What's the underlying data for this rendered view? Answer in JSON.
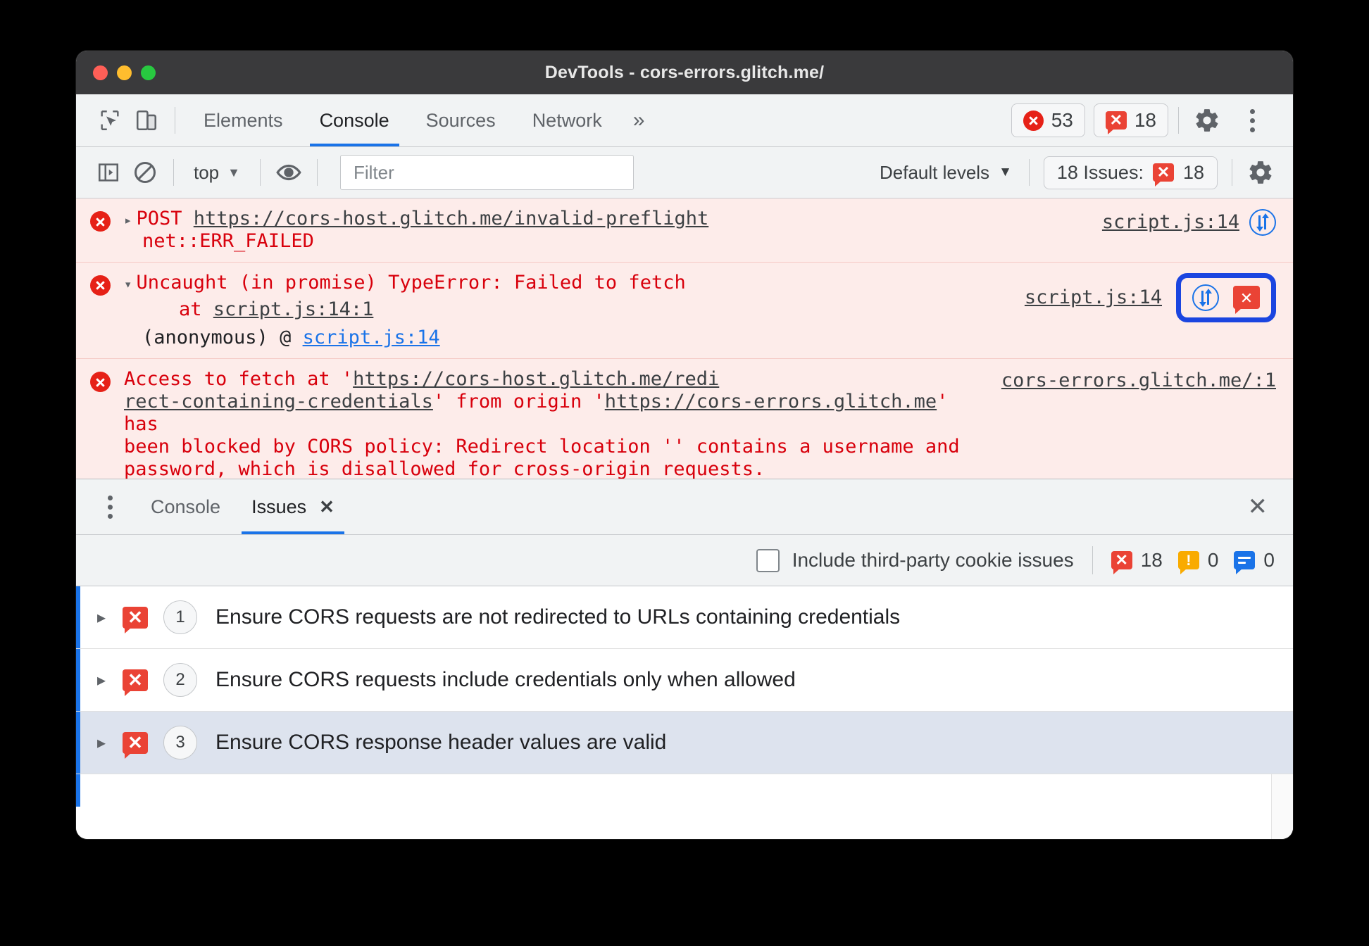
{
  "window": {
    "title": "DevTools - cors-errors.glitch.me/",
    "traffic_lights": [
      "close-red",
      "minimize-yellow",
      "maximize-green"
    ]
  },
  "main_toolbar": {
    "inspect_icon": "inspect-element-icon",
    "device_icon": "device-toolbar-icon",
    "tabs": [
      {
        "label": "Elements",
        "active": false
      },
      {
        "label": "Console",
        "active": true
      },
      {
        "label": "Sources",
        "active": false
      },
      {
        "label": "Network",
        "active": false
      }
    ],
    "more_tabs": "»",
    "error_count": "53",
    "issue_count": "18",
    "settings_icon": "gear-icon",
    "more_icon": "kebab-menu-icon"
  },
  "console_toolbar": {
    "sidebar_icon": "console-sidebar-icon",
    "clear_icon": "clear-console-icon",
    "context": "top",
    "context_caret": "▼",
    "eye_icon": "live-expression-eye-icon",
    "filter_placeholder": "Filter",
    "filter_value": "",
    "levels_label": "Default levels",
    "levels_caret": "▼",
    "issues_label": "18 Issues:",
    "issues_count": "18",
    "settings_icon": "console-settings-gear-icon"
  },
  "console_messages": [
    {
      "expander": "▸",
      "method": "POST",
      "url": "https://cors-host.glitch.me/invalid-preflight",
      "detail": "net::ERR_FAILED",
      "source": "script.js:14",
      "network_icon": "network-request-icon",
      "highlighted": false
    },
    {
      "expander": "▾",
      "text": "Uncaught (in promise) TypeError: Failed to fetch",
      "at_label": "at",
      "at_link": "script.js:14:1",
      "stack_prefix": "(anonymous) @ ",
      "stack_link": "script.js:14",
      "source": "script.js:14",
      "network_icon": "network-request-icon",
      "issue_icon": "issue-bubble-icon",
      "highlighted": true
    },
    {
      "line1_pre": "Access to fetch at '",
      "line1_link": "https://cors-host.glitch.me/redi",
      "line2_link": "rect-containing-credentials",
      "line2_mid": "' from origin '",
      "line2_link2": "https://cors-errors.glitch.me",
      "line2_post": "' has",
      "line3": "been blocked by CORS policy: Redirect location '' contains a username and",
      "line4": "password, which is disallowed for cross-origin requests.",
      "source": "cors-errors.glitch.me/:1",
      "highlighted": false
    }
  ],
  "drawer": {
    "kebab_icon": "drawer-more-icon",
    "tabs": [
      {
        "label": "Console",
        "active": false,
        "closable": false
      },
      {
        "label": "Issues",
        "active": true,
        "closable": true,
        "close_glyph": "✕"
      }
    ],
    "close_glyph": "✕"
  },
  "issues_toolbar": {
    "checkbox_label": "Include third-party cookie issues",
    "checkbox_checked": false,
    "error_count": "18",
    "warning_count": "0",
    "info_count": "0"
  },
  "issues_list": [
    {
      "expander": "▸",
      "badge": "issue-error-icon",
      "count": "1",
      "title": "Ensure CORS requests are not redirected to URLs containing credentials",
      "selected": false
    },
    {
      "expander": "▸",
      "badge": "issue-error-icon",
      "count": "2",
      "title": "Ensure CORS requests include credentials only when allowed",
      "selected": false
    },
    {
      "expander": "▸",
      "badge": "issue-error-icon",
      "count": "3",
      "title": "Ensure CORS response header values are valid",
      "selected": true
    }
  ],
  "colors": {
    "accent_blue": "#1a73e8",
    "highlight_blue": "#1b45e0",
    "error_red": "#d8000c",
    "error_bg": "#fdecea",
    "badge_red": "#ea4335",
    "warning_orange": "#f9ab00",
    "titlebar": "#3a3a3c",
    "toolbar_bg": "#f1f3f4",
    "selected_row": "#dde3ee"
  }
}
